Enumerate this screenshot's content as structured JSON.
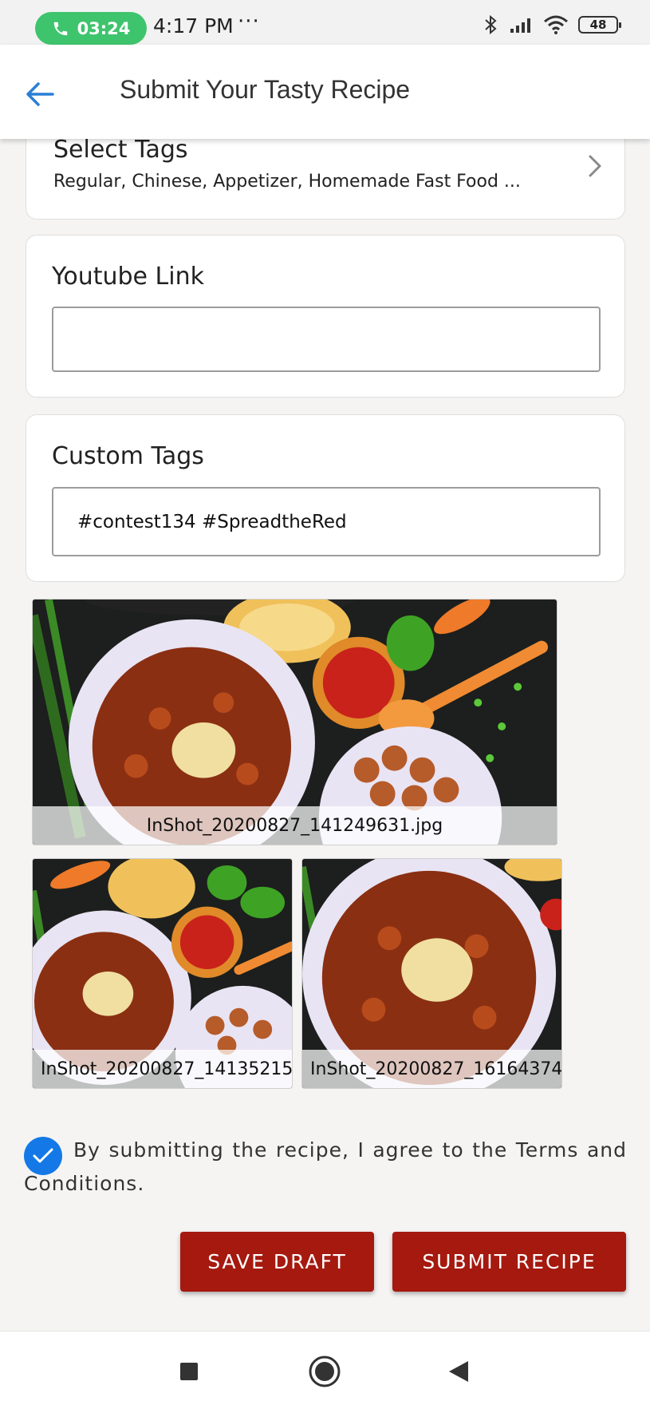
{
  "status_bar": {
    "call_timer": "03:24",
    "time": "4:17 PM",
    "more": "···",
    "battery": "48",
    "icons": [
      "phone-icon",
      "bluetooth-icon",
      "signal-icon",
      "wifi-icon",
      "battery-icon"
    ]
  },
  "app_bar": {
    "title": "Submit Your Tasty Recipe",
    "back_icon": "arrow-left-icon"
  },
  "tags_section": {
    "title": "Select Tags",
    "value": "Regular, Chinese, Appetizer, Homemade Fast Food ..."
  },
  "youtube": {
    "label": "Youtube Link",
    "value": ""
  },
  "custom_tags": {
    "label": "Custom Tags",
    "value": "#contest134 #SpreadtheRed"
  },
  "images": [
    {
      "filename": "InShot_20200827_141249631.jpg"
    },
    {
      "filename": "InShot_20200827_14135215"
    },
    {
      "filename": "InShot_20200827_16164374"
    }
  ],
  "agreement": {
    "checked": true,
    "text": "By submitting the recipe, I agree to the Terms and Conditions."
  },
  "buttons": {
    "save_draft": "SAVE DRAFT",
    "submit": "SUBMIT RECIPE"
  },
  "colors": {
    "accent_blue": "#1479e6",
    "button_red": "#a5190f",
    "call_green": "#3ec46d"
  }
}
